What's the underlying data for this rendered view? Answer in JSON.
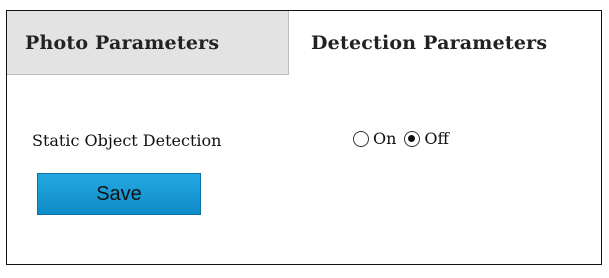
{
  "tabs": [
    {
      "label": "Photo Parameters",
      "active": false
    },
    {
      "label": "Detection Parameters",
      "active": true
    }
  ],
  "static_object_detection": {
    "label": "Static Object Detection",
    "options": [
      {
        "label": "On",
        "checked": false
      },
      {
        "label": "Off",
        "checked": true
      }
    ]
  },
  "save_button": {
    "label": "Save",
    "color": "#1a9ad6"
  }
}
